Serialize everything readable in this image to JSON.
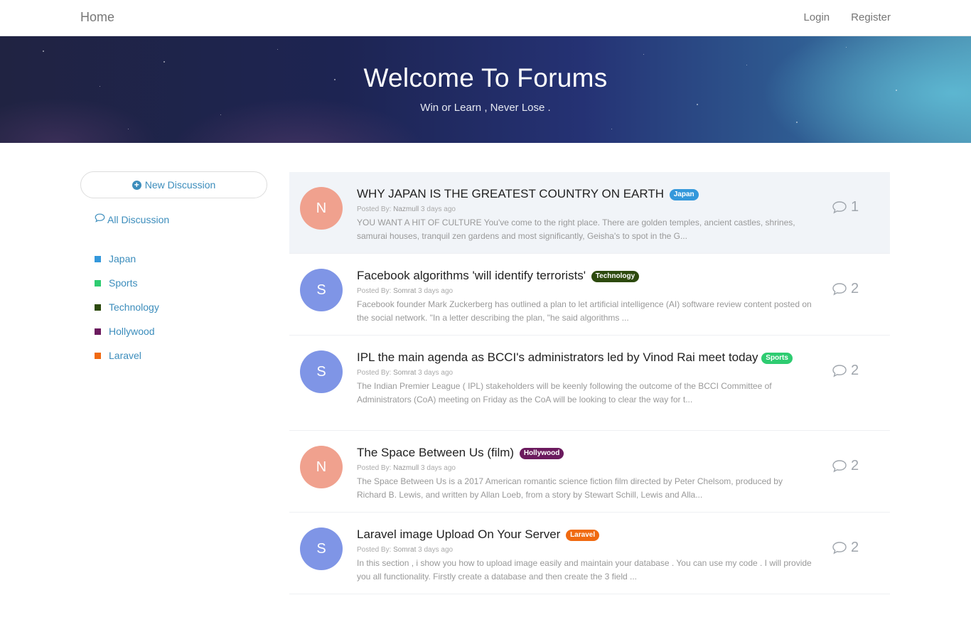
{
  "navbar": {
    "home": "Home",
    "login": "Login",
    "register": "Register"
  },
  "hero": {
    "title": "Welcome To Forums",
    "subtitle": "Win or Learn , Never Lose ."
  },
  "sidebar": {
    "new_discussion": "New Discussion",
    "all_discussion": "All Discussion",
    "channels": [
      {
        "label": "Japan",
        "color": "#3498db"
      },
      {
        "label": "Sports",
        "color": "#2ecc71"
      },
      {
        "label": "Technology",
        "color": "#2d4a0e"
      },
      {
        "label": "Hollywood",
        "color": "#6b1a5e"
      },
      {
        "label": "Laravel",
        "color": "#f06a11"
      }
    ]
  },
  "discussions": [
    {
      "avatar_letter": "N",
      "avatar_color": "#f0a18e",
      "title": "WHY JAPAN IS THE GREATEST COUNTRY ON EARTH",
      "tag": "Japan",
      "tag_color": "#3498db",
      "posted_by_label": "Posted By:",
      "author": "Nazmull",
      "time": "3 days ago",
      "excerpt": "YOU WANT A HIT OF CULTURE You've come to the right place. There are golden temples, ancient castles, shrines, samurai houses, tranquil zen gardens and most significantly, Geisha's to spot in the G...",
      "replies": "1"
    },
    {
      "avatar_letter": "S",
      "avatar_color": "#7f95e6",
      "title": "Facebook algorithms 'will identify terrorists'",
      "tag": "Technology",
      "tag_color": "#2d4a0e",
      "posted_by_label": "Posted By:",
      "author": "Somrat",
      "time": "3 days ago",
      "excerpt": "Facebook founder Mark Zuckerberg has outlined a plan to let artificial intelligence (AI) software review content posted on the social network. \"In a letter describing the plan, \"he said algorithms ...",
      "replies": "2"
    },
    {
      "avatar_letter": "S",
      "avatar_color": "#7f95e6",
      "title": "IPL the main agenda as BCCI's administrators led by Vinod Rai meet today",
      "tag": "Sports",
      "tag_color": "#2ecc71",
      "posted_by_label": "Posted By:",
      "author": "Somrat",
      "time": "3 days ago",
      "excerpt": "The Indian Premier League ( IPL) stakeholders will be keenly following the outcome of the BCCI Committee of Administrators (CoA) meeting on Friday as the CoA will be looking to clear the way for t...",
      "replies": "2"
    },
    {
      "avatar_letter": "N",
      "avatar_color": "#f0a18e",
      "title": "The Space Between Us (film)",
      "tag": "Hollywood",
      "tag_color": "#6b1a5e",
      "posted_by_label": "Posted By:",
      "author": "Nazmull",
      "time": "3 days ago",
      "excerpt": "The Space Between Us is a 2017 American romantic science fiction film directed by Peter Chelsom, produced by Richard B. Lewis, and written by Allan Loeb, from a story by Stewart Schill, Lewis and Alla...",
      "replies": "2"
    },
    {
      "avatar_letter": "S",
      "avatar_color": "#7f95e6",
      "title": "Laravel image Upload On Your Server",
      "tag": "Laravel",
      "tag_color": "#f06a11",
      "posted_by_label": "Posted By:",
      "author": "Somrat",
      "time": "3 days ago",
      "excerpt": "In this section , i show you how to upload image easily and maintain your database . You can use my code . I will provide you all functionality. Firstly create a database and then create the 3 field ...",
      "replies": "2"
    }
  ]
}
